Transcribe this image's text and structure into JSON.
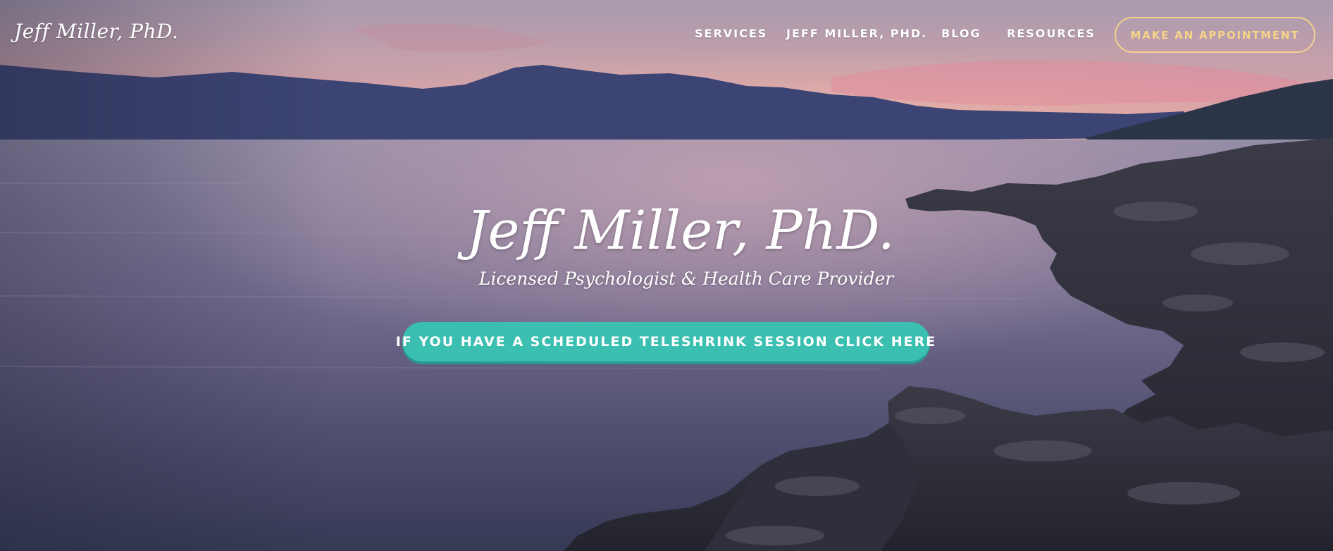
{
  "header": {
    "logo_text": "Jeff Miller, PhD.",
    "nav": {
      "services": "SERVICES",
      "jeff": "JEFF MILLER, PHD.",
      "blog": "BLOG",
      "resources": "RESOURCES"
    },
    "appointment_button": "MAKE AN APPOINTMENT"
  },
  "hero": {
    "title": "Jeff Miller, PhD.",
    "subtitle": "Licensed Psychologist & Health Care Provider",
    "cta_button": "IF YOU HAVE A SCHEDULED TELESHRINK SESSION CLICK HERE",
    "background": "sunset-lake-with-rocky-shore"
  },
  "colors": {
    "accent_teal": "#3bbfb0",
    "appointment_gold": "#f7d38a",
    "text_white": "#ffffff"
  }
}
